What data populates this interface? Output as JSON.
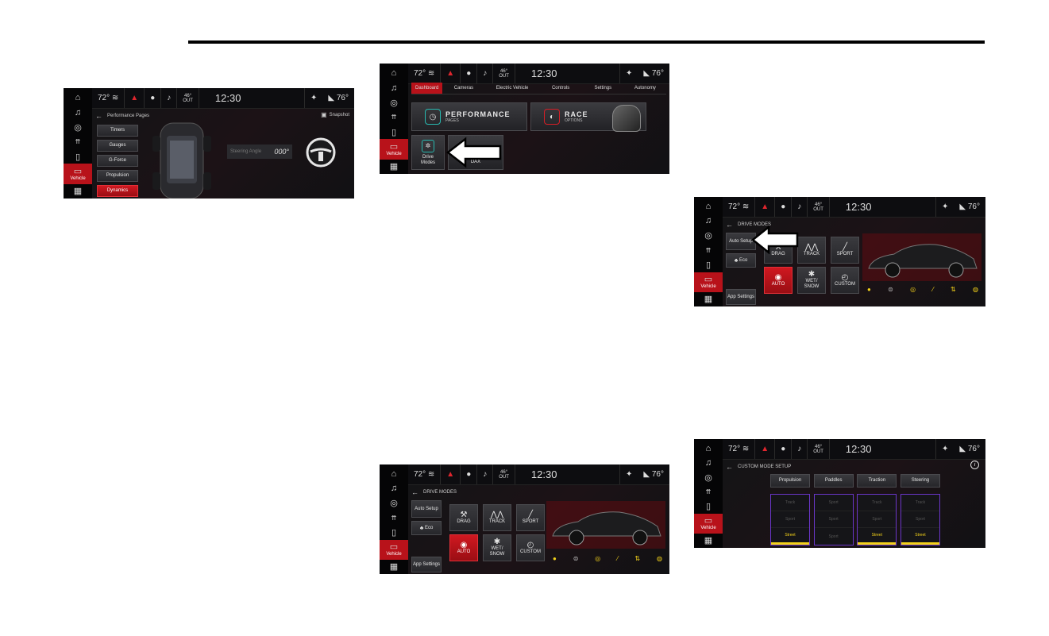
{
  "status": {
    "temp_left": "72°",
    "clock": "12:30",
    "outside_temp": "46°",
    "outside_label": "OUT",
    "temp_right": "76°"
  },
  "rail": {
    "vehicle_label": "Vehicle"
  },
  "screen1": {
    "back_title": "Performance Pages",
    "snapshot_label": "Snapshot",
    "menu": [
      "Timers",
      "Gauges",
      "G-Force",
      "Propulsion",
      "Dynamics"
    ],
    "active_menu": "Dynamics",
    "steering_label": "Steering Angle",
    "steering_value": "000°"
  },
  "screen2": {
    "tabs": [
      "Dashboard",
      "Cameras",
      "Electric Vehicle",
      "Controls",
      "Settings",
      "Autonomy"
    ],
    "active_tab": "Dashboard",
    "performance_title": "PERFORMANCE",
    "performance_sub": "PAGES",
    "race_title": "RACE",
    "race_sub": "OPTIONS",
    "drive_modes_label": "Drive Modes",
    "partial_tile_label": "DAX"
  },
  "drive_modes": {
    "title": "DRIVE MODES",
    "auto_setup": "Auto Setup",
    "eco": "Eco",
    "app_settings": "App Settings",
    "modes": [
      "DRAG",
      "TRACK",
      "SPORT",
      "AUTO",
      "WET/ SNOW",
      "CUSTOM"
    ],
    "active_mode": "AUTO"
  },
  "screen5": {
    "title": "CUSTOM MODE SETUP",
    "columns": [
      "Propulsion",
      "Paddles",
      "Traction",
      "Steering"
    ],
    "options": [
      [
        "Track",
        "Sport",
        "Street"
      ],
      [
        "Sport",
        "Sport",
        "Sport"
      ],
      [
        "Track",
        "Sport",
        "Street"
      ],
      [
        "Track",
        "Sport",
        "Street"
      ]
    ],
    "selected": [
      "Street",
      "",
      "Street",
      "Street"
    ]
  },
  "colors": {
    "accent_red": "#c8141c",
    "highlight_yellow": "#f3d21a",
    "purple_border": "#6a36c8"
  }
}
